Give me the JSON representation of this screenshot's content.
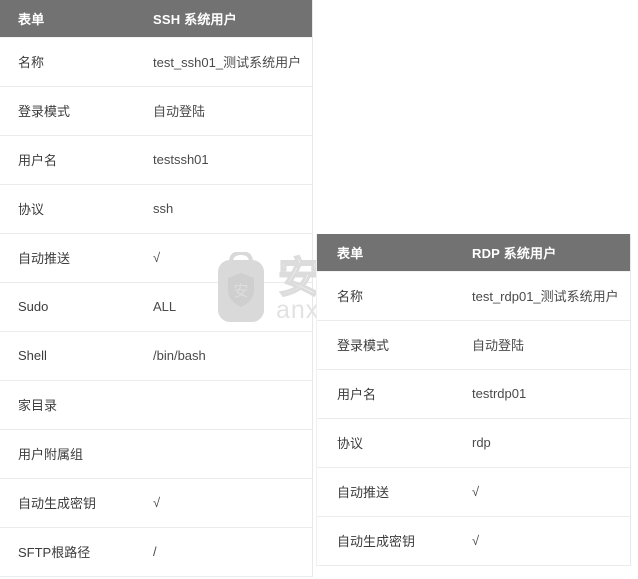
{
  "ssh_table": {
    "header": {
      "label_col": "表单",
      "value_col": "SSH 系统用户"
    },
    "rows": [
      {
        "label": "名称",
        "value": "test_ssh01_测试系统用户"
      },
      {
        "label": "登录模式",
        "value": "自动登陆"
      },
      {
        "label": "用户名",
        "value": "testssh01"
      },
      {
        "label": "协议",
        "value": "ssh"
      },
      {
        "label": "自动推送",
        "value": "√"
      },
      {
        "label": "Sudo",
        "value": "ALL"
      },
      {
        "label": "Shell",
        "value": "/bin/bash"
      },
      {
        "label": "家目录",
        "value": ""
      },
      {
        "label": "用户附属组",
        "value": ""
      },
      {
        "label": "自动生成密钥",
        "value": "√"
      },
      {
        "label": "SFTP根路径",
        "value": "/"
      }
    ]
  },
  "rdp_table": {
    "header": {
      "label_col": "表单",
      "value_col": "RDP 系统用户"
    },
    "rows": [
      {
        "label": "名称",
        "value": "test_rdp01_测试系统用户"
      },
      {
        "label": "登录模式",
        "value": "自动登陆"
      },
      {
        "label": "用户名",
        "value": "testrdp01"
      },
      {
        "label": "协议",
        "value": "rdp"
      },
      {
        "label": "自动推送",
        "value": "√"
      },
      {
        "label": "自动生成密钥",
        "value": "√"
      }
    ]
  },
  "watermark": {
    "brand_cn": "安下载",
    "brand_url": "anxz.com",
    "bag_glyph": "安",
    "color": "#d8d8d8"
  },
  "colors": {
    "header_bg": "#727272",
    "header_text": "#ffffff",
    "row_divider": "#ececec",
    "body_text": "#3c3c3c",
    "page_bg": "#ffffff"
  }
}
